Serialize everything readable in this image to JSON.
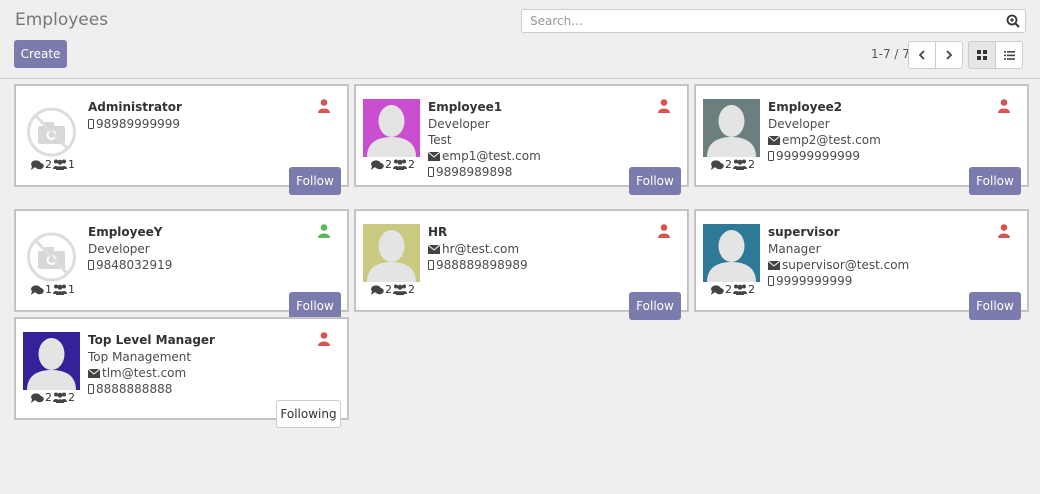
{
  "app": {
    "title": "Employees",
    "search_placeholder": "Search...",
    "create_label": "Create",
    "pager_value": "1-7 / 7"
  },
  "employees": [
    {
      "name": "Administrator",
      "lines": [
        "98989999999"
      ],
      "line_icons": [
        "mobile"
      ],
      "messages": "2",
      "followers": "1",
      "photo": "placeholder",
      "status": "absent",
      "follow_label": "Follow"
    },
    {
      "name": "Employee1",
      "lines": [
        "Developer",
        "Test",
        "emp1@test.com",
        "9898989898"
      ],
      "line_icons": [
        "",
        "",
        "envelope",
        "mobile"
      ],
      "messages": "2",
      "followers": "2",
      "photo": "avatar",
      "photo_color": "#c94fd0",
      "status": "absent",
      "follow_label": "Follow"
    },
    {
      "name": "Employee2",
      "lines": [
        "Developer",
        "emp2@test.com",
        "99999999999"
      ],
      "line_icons": [
        "",
        "envelope",
        "mobile"
      ],
      "messages": "2",
      "followers": "2",
      "photo": "avatar",
      "photo_color": "#6b7f7e",
      "status": "absent",
      "follow_label": "Follow"
    },
    {
      "name": "EmployeeY",
      "lines": [
        "Developer",
        "9848032919"
      ],
      "line_icons": [
        "",
        "mobile"
      ],
      "messages": "1",
      "followers": "1",
      "photo": "placeholder",
      "status": "present",
      "follow_label": "Follow"
    },
    {
      "name": "HR",
      "lines": [
        "hr@test.com",
        "988889898989"
      ],
      "line_icons": [
        "envelope",
        "mobile"
      ],
      "messages": "2",
      "followers": "2",
      "photo": "avatar",
      "photo_color": "#c9c97f",
      "status": "absent",
      "follow_label": "Follow"
    },
    {
      "name": "supervisor",
      "lines": [
        "Manager",
        "supervisor@test.com",
        "9999999999"
      ],
      "line_icons": [
        "",
        "envelope",
        "mobile"
      ],
      "messages": "2",
      "followers": "2",
      "photo": "avatar",
      "photo_color": "#2e7a96",
      "status": "absent",
      "follow_label": "Follow"
    },
    {
      "name": "Top Level Manager",
      "lines": [
        "Top Management",
        "tlm@test.com",
        "8888888888"
      ],
      "line_icons": [
        "",
        "envelope",
        "mobile"
      ],
      "messages": "2",
      "followers": "2",
      "photo": "avatar",
      "photo_color": "#35219a",
      "status": "absent",
      "follow_label": "Following"
    }
  ],
  "colors": {
    "accent": "#7c7bad",
    "status_absent": "#d9534f",
    "status_present": "#5cb85c"
  }
}
